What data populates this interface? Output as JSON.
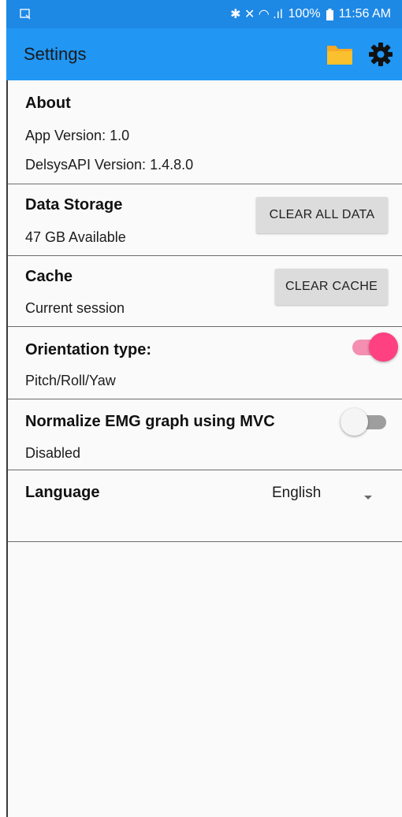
{
  "status_bar": {
    "icon_left": "screenshot-notification-icon",
    "signal_glyphs": "✱ ✕ ◠ .ıl",
    "battery": "100%",
    "time": "11:56 AM"
  },
  "app_bar": {
    "title": "Settings",
    "folder_icon": "folder-icon",
    "gear_icon": "gear-icon"
  },
  "sections": {
    "about": {
      "title": "About",
      "app_version": "App Version: 1.0",
      "api_version": "DelsysAPI Version: 1.4.8.0"
    },
    "storage": {
      "title": "Data Storage",
      "available": "47 GB Available",
      "button": "CLEAR ALL DATA"
    },
    "cache": {
      "title": "Cache",
      "subtitle": "Current session",
      "button": "CLEAR CACHE"
    },
    "orientation": {
      "title": "Orientation type:",
      "value": "Pitch/Roll/Yaw",
      "toggle_on": true
    },
    "normalize": {
      "title": "Normalize EMG graph using MVC",
      "value": "Disabled",
      "toggle_on": false
    },
    "language": {
      "title": "Language",
      "selected": "English"
    }
  },
  "colors": {
    "status_bar": "#1e88e5",
    "app_bar": "#2196f3",
    "folder": "#f9a825",
    "toggle_on_thumb": "#ff4081",
    "toggle_on_track": "#f48fb1",
    "toggle_off_thumb": "#f5f5f5",
    "toggle_off_track": "#9e9e9e"
  }
}
